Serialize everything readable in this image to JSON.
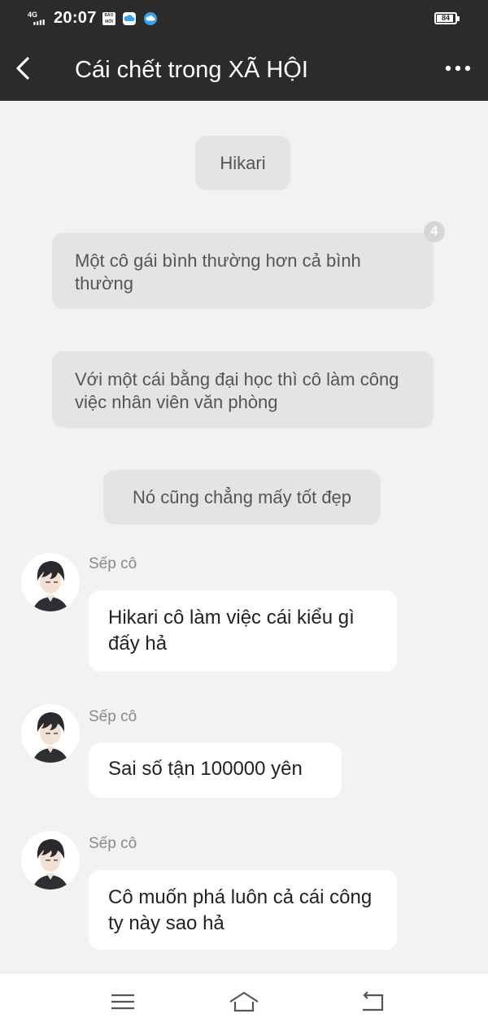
{
  "status_bar": {
    "network": "4G",
    "time": "20:07",
    "news_icon_text": "BÁO MỚI",
    "battery": "84"
  },
  "header": {
    "title": "Cái chết trong XÃ HỘI",
    "back_icon": "chevron-left-icon",
    "more_icon": "more-horizontal-icon"
  },
  "chat": {
    "narration": [
      {
        "text": "Hikari"
      },
      {
        "text": "Một cô gái bình thường hơn cả bình thường",
        "badge": "4"
      },
      {
        "text": "Với một cái bằng đại học thì cô làm công việc nhân viên văn phòng"
      },
      {
        "text": "Nó cũng chẳng mấy tốt đẹp"
      }
    ],
    "messages": [
      {
        "sender": "Sếp cô",
        "text": "Hikari cô làm việc cái kiểu gì đấy hả"
      },
      {
        "sender": "Sếp cô",
        "text": "Sai số tận 100000 yên"
      },
      {
        "sender": "Sếp cô",
        "text": "Cô muốn phá luôn cả cái công ty này sao hả"
      }
    ]
  },
  "nav": {
    "menu_icon": "menu-icon",
    "home_icon": "home-icon",
    "back_icon": "back-icon"
  },
  "colors": {
    "header_bg": "#2b2b2b",
    "chat_bg": "#f2f2f2",
    "narration_bubble": "#e4e4e4",
    "message_bubble": "#ffffff"
  }
}
